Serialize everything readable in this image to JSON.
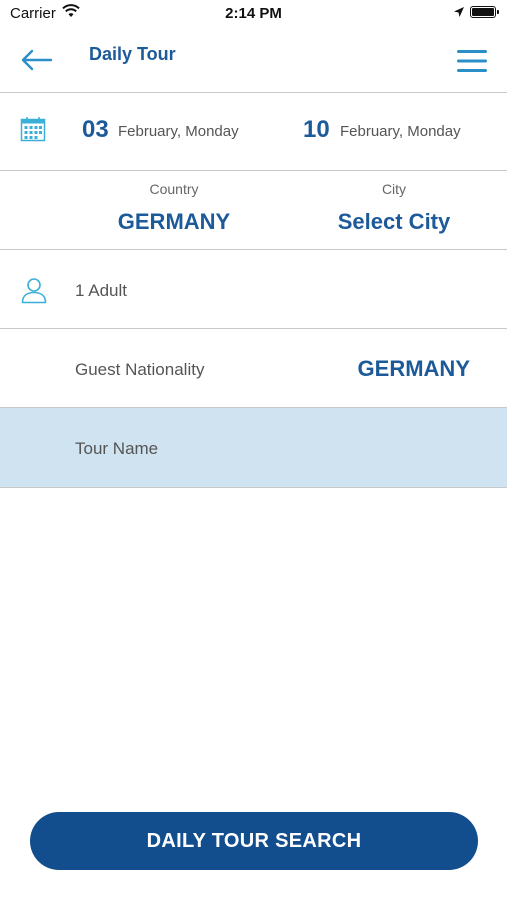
{
  "status_bar": {
    "carrier": "Carrier",
    "time": "2:14 PM"
  },
  "nav": {
    "title": "Daily Tour",
    "back_icon": "arrow-left-icon",
    "menu_icon": "hamburger-menu-icon"
  },
  "dates": {
    "icon": "calendar-icon",
    "start": {
      "day": "03",
      "text": "February, Monday"
    },
    "end": {
      "day": "10",
      "text": "February, Monday"
    }
  },
  "location": {
    "country_label": "Country",
    "country_value": "GERMANY",
    "city_label": "City",
    "city_value": "Select City"
  },
  "guests": {
    "icon": "person-icon",
    "text": "1 Adult"
  },
  "nationality": {
    "label": "Guest Nationality",
    "value": "GERMANY"
  },
  "tour": {
    "placeholder": "Tour Name",
    "value": ""
  },
  "search_button": {
    "label": "DAILY TOUR SEARCH"
  },
  "colors": {
    "accent": "#1d5a9a",
    "button": "#124e8d",
    "highlight": "#cfe3f0",
    "icon": "#3ab0d8"
  }
}
